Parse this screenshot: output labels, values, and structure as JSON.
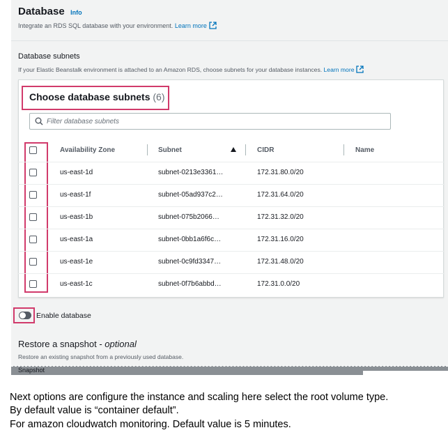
{
  "section": {
    "title": "Database",
    "info": "Info",
    "description": "Integrate an RDS SQL database with your environment.",
    "learn_more": "Learn more"
  },
  "subnets": {
    "label": "Database subnets",
    "description": "If your Elastic Beanstalk environment is attached to an Amazon RDS, choose subnets for your database instances.",
    "learn_more": "Learn more",
    "table_title": "Choose database subnets",
    "count": "(6)",
    "filter_placeholder": "Filter database subnets",
    "columns": [
      "Availability Zone",
      "Subnet",
      "CIDR",
      "Name"
    ],
    "rows": [
      {
        "az": "us-east-1d",
        "subnet": "subnet-0213e3361…",
        "cidr": "172.31.80.0/20",
        "name": ""
      },
      {
        "az": "us-east-1f",
        "subnet": "subnet-05ad937c2…",
        "cidr": "172.31.64.0/20",
        "name": ""
      },
      {
        "az": "us-east-1b",
        "subnet": "subnet-075b2066…",
        "cidr": "172.31.32.0/20",
        "name": ""
      },
      {
        "az": "us-east-1a",
        "subnet": "subnet-0bb1a6f6c…",
        "cidr": "172.31.16.0/20",
        "name": ""
      },
      {
        "az": "us-east-1e",
        "subnet": "subnet-0c9fd3347…",
        "cidr": "172.31.48.0/20",
        "name": ""
      },
      {
        "az": "us-east-1c",
        "subnet": "subnet-0f7b6abbd…",
        "cidr": "172.31.0.0/20",
        "name": ""
      }
    ]
  },
  "enable_database": {
    "label": "Enable database",
    "enabled": false
  },
  "snapshot": {
    "title": "Restore a snapshot - ",
    "optional": "optional",
    "description": "Restore an existing snapshot from a previously used database.",
    "field_label": "Snapshot"
  },
  "caption": [
    "Next options are configure the instance and scaling here select the root volume type.",
    "By default value is “container default”.",
    "For amazon cloudwatch monitoring. Default value is 5 minutes."
  ],
  "colors": {
    "accent": "#0073bb",
    "highlight": "#d13a6b"
  }
}
